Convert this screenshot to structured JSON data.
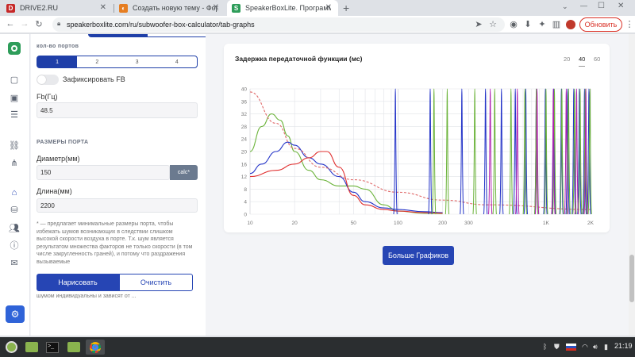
{
  "tabs": [
    {
      "label": "DRIVE2.RU",
      "icon": "D"
    },
    {
      "label": "Создать новую тему - Форум",
      "icon": "◐"
    },
    {
      "label": "SpeakerBoxLite. Программа",
      "icon": "S"
    }
  ],
  "new_tab_icon": "+",
  "address": "speakerboxlite.com/ru/subwoofer-box-calculator/tab-graphs",
  "update_button": "Обновить",
  "sidepanel": {
    "ports_label": "кол-во портов",
    "ports_options": [
      "1",
      "2",
      "3",
      "4"
    ],
    "fix_fb_label": "Зафиксировать FB",
    "fb_label": "Fb(Гц)",
    "fb_value": "48.5",
    "port_section": "РАЗМЕРЫ ПОРТА",
    "diameter_label": "Диаметр(мм)",
    "diameter_value": "150",
    "calc_label": "calc*",
    "length_label": "Длина(мм)",
    "length_value": "2200",
    "note": "* — предлагает минимальные размеры порта, чтобы избежать шумов возникающих в следствии слишком высокой скорости воздуха в порте. Т.к. шум является результатом множества факторов не только скорости (в том числе закругленность граней), и потому что раздражения вызываемые",
    "note_tail": "шумом индивидуальны и зависят от ...",
    "draw_button": "Нарисовать",
    "clear_button": "Очистить"
  },
  "chart_card": {
    "title": "Задержка передаточной функции (мс)",
    "zoom_options": [
      "20",
      "40",
      "60"
    ],
    "zoom_selected": "40"
  },
  "more_button": "Больше Графиков",
  "clock": "21:19",
  "chart_data": {
    "type": "line",
    "title": "Задержка передаточной функции (мс)",
    "xscale": "log",
    "xlim": [
      10,
      2000
    ],
    "ylim": [
      0,
      40
    ],
    "xticks": [
      "10",
      "20",
      "50",
      "100",
      "200",
      "300",
      "1K",
      "2K"
    ],
    "yticks": [
      "0",
      "4",
      "8",
      "12",
      "16",
      "20",
      "24",
      "28",
      "32",
      "36",
      "40"
    ],
    "grid": true,
    "series": [
      {
        "color": "#6bb33a",
        "x": [
          10,
          12,
          14,
          16,
          18,
          20,
          25,
          30,
          40,
          50,
          60,
          80,
          100,
          150,
          200
        ],
        "y": [
          20,
          28,
          32,
          30,
          25,
          20,
          14,
          11,
          9,
          9,
          8,
          3,
          1,
          0.3,
          0.2
        ]
      },
      {
        "color": "#2434c8",
        "x": [
          10,
          12,
          15,
          18,
          20,
          25,
          30,
          40,
          50,
          60,
          80,
          100,
          150,
          200
        ],
        "y": [
          13,
          16,
          20,
          23,
          22,
          18,
          16,
          12,
          7,
          4,
          2,
          1.5,
          0.8,
          0.5
        ]
      },
      {
        "color": "#e03030",
        "x": [
          10,
          15,
          20,
          25,
          30,
          33,
          40,
          50,
          60,
          80,
          100,
          150,
          200
        ],
        "y": [
          12,
          14,
          16,
          18,
          20,
          20,
          15,
          6,
          3,
          1.5,
          1,
          0.5,
          0.3
        ]
      },
      {
        "color": "#e06a6a",
        "dashed": true,
        "x": [
          10,
          15,
          20,
          30,
          50,
          100,
          200,
          400,
          2000
        ],
        "y": [
          39,
          29,
          21,
          15,
          11,
          7,
          4.5,
          3,
          1.5
        ]
      }
    ],
    "resonance_peaks": [
      {
        "color": "#2434c8",
        "x": [
          96,
          165,
          270,
          390,
          500,
          620,
          730,
          860,
          990,
          1130,
          1270,
          1400,
          1540,
          1680,
          1820,
          1950
        ]
      },
      {
        "color": "#6bb33a",
        "x": [
          175,
          215,
          330,
          450,
          580,
          720,
          860,
          1000,
          1140,
          1280,
          1420,
          1560,
          1700,
          1840,
          1980
        ]
      },
      {
        "color": "#b020b0",
        "x": [
          420,
          640,
          870,
          1120,
          1370,
          1610,
          1860
        ]
      }
    ]
  }
}
